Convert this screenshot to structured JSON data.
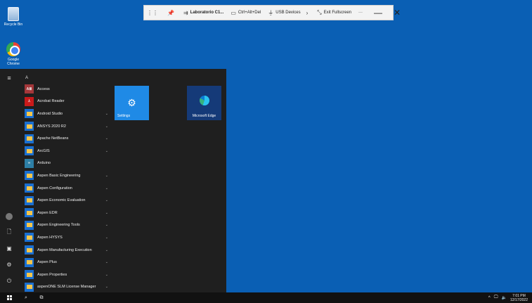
{
  "desktop": {
    "icons": [
      {
        "label": "Recycle Bin"
      },
      {
        "label": "Google Chrome"
      }
    ]
  },
  "remote_toolbar": {
    "pin": "pin-icon",
    "connection_name": "Laboratorio C1...",
    "ctrl_alt_del": "Ctrl+Alt+Del",
    "usb_devices": "USB Devices",
    "exit_fullscreen": "Exit Fullscreen",
    "more": "···",
    "minimize": "—",
    "close": "✕"
  },
  "start_menu": {
    "letter": "A",
    "apps": [
      {
        "label": "Access",
        "tile": "A≣",
        "style": "t-access",
        "expand": false
      },
      {
        "label": "Acrobat Reader",
        "tile": "⅄",
        "style": "t-acrobat",
        "expand": false
      },
      {
        "label": "Android Studio",
        "tile": "",
        "style": "t-folder",
        "expand": true
      },
      {
        "label": "ANSYS 2020 R2",
        "tile": "",
        "style": "t-folder",
        "expand": true
      },
      {
        "label": "Apache NetBeans",
        "tile": "",
        "style": "t-folder",
        "expand": true
      },
      {
        "label": "ArcGIS",
        "tile": "",
        "style": "t-folder",
        "expand": true
      },
      {
        "label": "Arduino",
        "tile": "∞",
        "style": "t-arduino",
        "expand": false
      },
      {
        "label": "Aspen Basic Engineering",
        "tile": "",
        "style": "t-folder",
        "expand": true
      },
      {
        "label": "Aspen Configuration",
        "tile": "",
        "style": "t-folder",
        "expand": true
      },
      {
        "label": "Aspen Economic Evaluation",
        "tile": "",
        "style": "t-folder",
        "expand": true
      },
      {
        "label": "Aspen EDR",
        "tile": "",
        "style": "t-folder",
        "expand": true
      },
      {
        "label": "Aspen Engineering Tools",
        "tile": "",
        "style": "t-folder",
        "expand": true
      },
      {
        "label": "Aspen HYSYS",
        "tile": "",
        "style": "t-folder",
        "expand": true
      },
      {
        "label": "Aspen Manufacturing Execution",
        "tile": "",
        "style": "t-folder",
        "expand": true
      },
      {
        "label": "Aspen Plus",
        "tile": "",
        "style": "t-folder",
        "expand": true
      },
      {
        "label": "Aspen Properties",
        "tile": "",
        "style": "t-folder",
        "expand": true
      },
      {
        "label": "aspenONE SLM License Manager",
        "tile": "",
        "style": "t-folder",
        "expand": true
      }
    ],
    "tiles": {
      "settings": "Settings",
      "edge": "Microsoft Edge"
    }
  },
  "taskbar": {
    "time": "7:01 PM",
    "date": "12/17/2022"
  }
}
